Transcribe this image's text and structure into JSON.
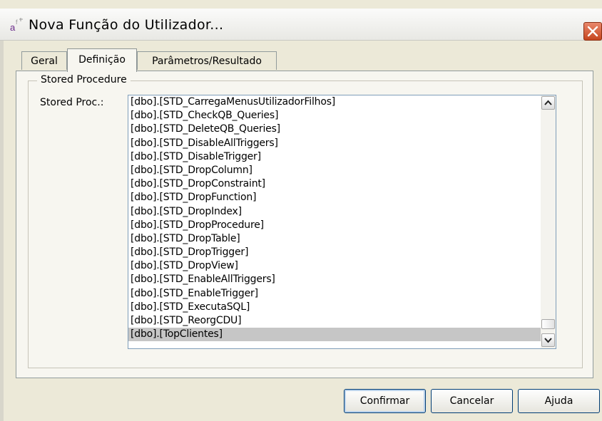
{
  "window": {
    "title": "Nova Função do Utilizador..."
  },
  "tabs": [
    {
      "label": "Geral",
      "active": false
    },
    {
      "label": "Definição",
      "active": true
    },
    {
      "label": "Parâmetros/Resultado",
      "active": false
    }
  ],
  "group": {
    "title": "Stored Procedure",
    "field_label": "Stored Proc.:"
  },
  "procedures": [
    "[dbo].[STD_CarregaMenusUtilizadorFilhos]",
    "[dbo].[STD_CheckQB_Queries]",
    "[dbo].[STD_DeleteQB_Queries]",
    "[dbo].[STD_DisableAllTriggers]",
    "[dbo].[STD_DisableTrigger]",
    "[dbo].[STD_DropColumn]",
    "[dbo].[STD_DropConstraint]",
    "[dbo].[STD_DropFunction]",
    "[dbo].[STD_DropIndex]",
    "[dbo].[STD_DropProcedure]",
    "[dbo].[STD_DropTable]",
    "[dbo].[STD_DropTrigger]",
    "[dbo].[STD_DropView]",
    "[dbo].[STD_EnableAllTriggers]",
    "[dbo].[STD_EnableTrigger]",
    "[dbo].[STD_ExecutaSQL]",
    "[dbo].[STD_ReorgCDU]",
    "[dbo].[TopClientes]"
  ],
  "selected_procedure": "[dbo].[TopClientes]",
  "buttons": {
    "confirm": "Confirmar",
    "cancel": "Cancelar",
    "help": "Ajuda"
  },
  "colors": {
    "close_button": "#c5451e",
    "selection": "#c6c6c6",
    "dialog_bg": "#ece9d8"
  }
}
